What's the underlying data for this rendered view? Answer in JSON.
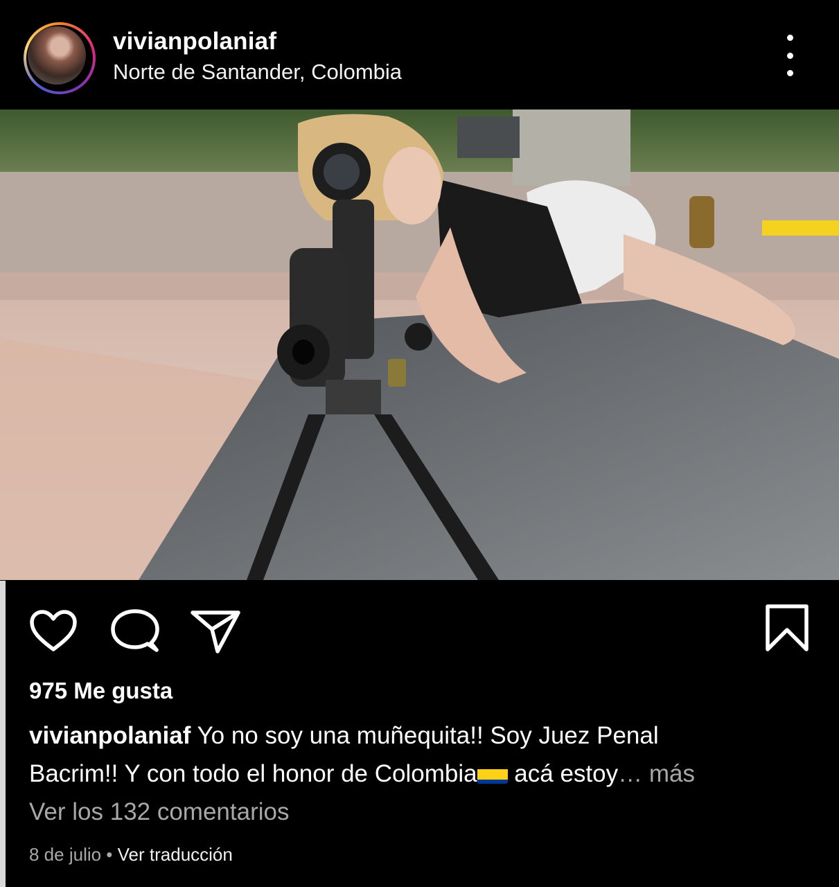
{
  "post": {
    "username": "vivianpolaniaf",
    "location": "Norte de Santander, Colombia",
    "likes": "975 Me gusta",
    "caption_user": "vivianpolaniaf",
    "caption_line1": "Yo no soy una muñequita!! Soy Juez Penal",
    "caption_line2_a": "Bacrim!! Y con todo el honor de Colombia",
    "caption_line2_b": " acá estoy",
    "caption_more": "… más",
    "view_comments": "Ver los 132 comentarios",
    "date": "8 de julio",
    "separator": " • ",
    "translate": "Ver traducción"
  },
  "icons": {
    "more": "more-vertical-icon",
    "like": "heart-icon",
    "comment": "comment-icon",
    "share": "send-icon",
    "save": "bookmark-icon",
    "flag": "colombia-flag-icon"
  },
  "colors": {
    "background": "#000000",
    "text": "#ffffff",
    "secondary_text": "#a8a8a8",
    "flag_yellow": "#fcd116",
    "flag_blue": "#003893",
    "flag_red": "#ce1126"
  }
}
